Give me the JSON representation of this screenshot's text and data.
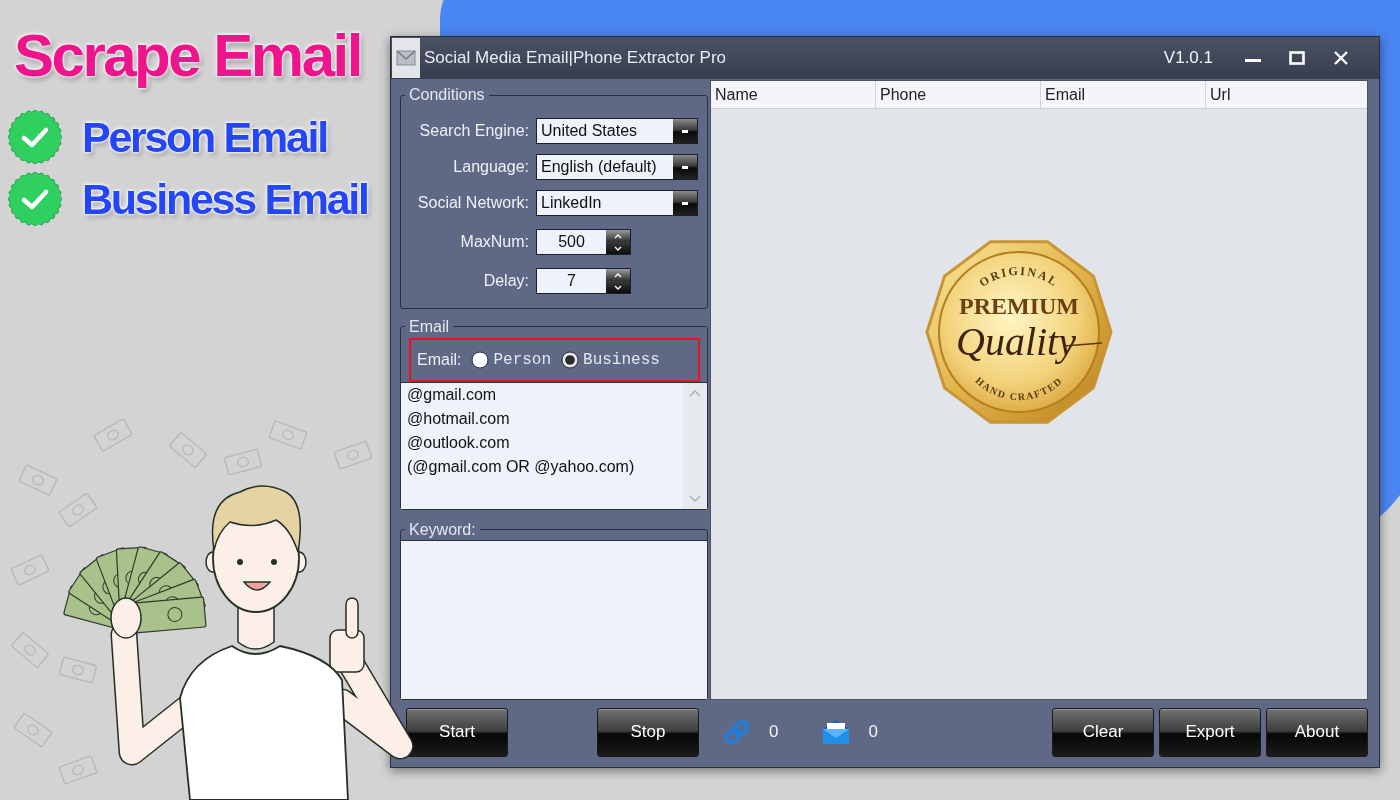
{
  "promo": {
    "headline": "Scrape Email",
    "features": [
      {
        "label": "Person Email",
        "checked": true
      },
      {
        "label": "Business Email",
        "checked": true
      }
    ]
  },
  "window": {
    "title": "Social Media Email|Phone Extractor Pro",
    "version": "V1.0.1"
  },
  "conditions": {
    "title": "Conditions",
    "fields": [
      {
        "kind": "dropdown",
        "label": "Search Engine:",
        "value": "United States"
      },
      {
        "kind": "dropdown",
        "label": "Language:",
        "value": "English (default)"
      },
      {
        "kind": "dropdown",
        "label": "Social Network:",
        "value": "LinkedIn"
      },
      {
        "kind": "spinner",
        "label": "MaxNum:",
        "value": "500"
      },
      {
        "kind": "spinner",
        "label": "Delay:",
        "value": "7"
      }
    ]
  },
  "email": {
    "title": "Email",
    "label": "Email:",
    "highlighted": true,
    "options": [
      {
        "label": "Person",
        "selected": false
      },
      {
        "label": "Business",
        "selected": true
      }
    ],
    "domains": [
      "@gmail.com",
      "@hotmail.com",
      "@outlook.com",
      "(@gmail.com OR @yahoo.com)"
    ]
  },
  "keyword": {
    "title": "Keyword:"
  },
  "table": {
    "columns": [
      "Name",
      "Phone",
      "Email",
      "Url"
    ],
    "seal": {
      "top": "ORIGINAL",
      "title": "PREMIUM",
      "script": "Quality",
      "bottom": "HAND CRAFTED"
    }
  },
  "footer": {
    "left_buttons": [
      "Start",
      "Stop"
    ],
    "counters": [
      {
        "kind": "link",
        "value": "0"
      },
      {
        "kind": "mail",
        "value": "0"
      }
    ],
    "right_buttons": [
      "Clear",
      "Export",
      "About"
    ]
  }
}
